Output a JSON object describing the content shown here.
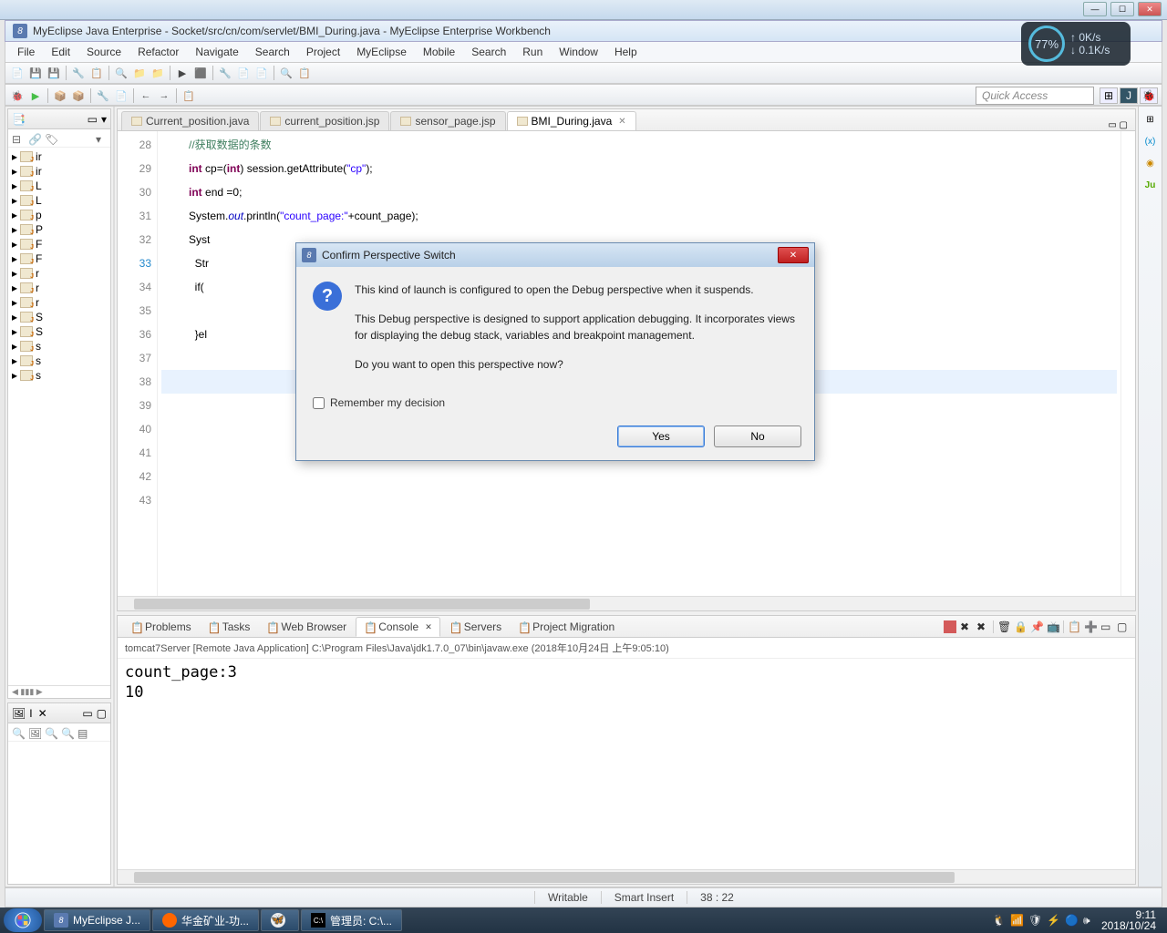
{
  "window": {
    "title": "MyEclipse Java Enterprise - Socket/src/cn/com/servlet/BMI_During.java - MyEclipse Enterprise Workbench"
  },
  "menu": [
    "File",
    "Edit",
    "Source",
    "Refactor",
    "Navigate",
    "Search",
    "Project",
    "MyEclipse",
    "Mobile",
    "Search",
    "Run",
    "Window",
    "Help"
  ],
  "quick_access": "Quick Access",
  "net": {
    "pct": "77%",
    "up": "0K/s",
    "down": "0.1K/s"
  },
  "editor_tabs": [
    {
      "label": "Current_position.java"
    },
    {
      "label": "current_position.jsp"
    },
    {
      "label": "sensor_page.jsp"
    },
    {
      "label": "BMI_During.java",
      "active": true
    }
  ],
  "gutter": [
    "28",
    "29",
    "30",
    "31",
    "32",
    "33",
    "34",
    "35",
    "36",
    "37",
    "38",
    "39",
    "40",
    "41",
    "42",
    "43"
  ],
  "code_lines": {
    "l28c": "//获取数据的条数",
    "l29a": "int",
    "l29b": "cp=(",
    "l29c": "int",
    "l29d": ") session.getAttribute(",
    "l29e": "\"cp\"",
    "l29f": ");",
    "l30a": "int",
    "l30b": "end =0;",
    "l31a": "System.",
    "l31b": "out",
    "l31c": ".println(",
    "l31d": "\"count_page:\"",
    "l31e": "+count_page);",
    "l32": "Syst",
    "l33": " Str",
    "l34": " if(",
    "l36": " }el"
  },
  "pkg_items": [
    "ir",
    "ir",
    "L",
    "L",
    "p",
    "P",
    "F",
    "F",
    "r",
    "r",
    "r",
    "S",
    "S",
    "s",
    "s",
    "s"
  ],
  "image_tab": "I",
  "console_tabs": [
    {
      "label": "Problems"
    },
    {
      "label": "Tasks"
    },
    {
      "label": "Web Browser"
    },
    {
      "label": "Console",
      "active": true
    },
    {
      "label": "Servers"
    },
    {
      "label": "Project Migration"
    }
  ],
  "console_title": "tomcat7Server [Remote Java Application] C:\\Program Files\\Java\\jdk1.7.0_07\\bin\\javaw.exe (2018年10月24日 上午9:05:10)",
  "console_body": "count_page:3\n10",
  "status": {
    "mode": "Writable",
    "ins": "Smart Insert",
    "pos": "38 : 22"
  },
  "dialog": {
    "title": "Confirm Perspective Switch",
    "p1": "This kind of launch is configured to open the Debug perspective when it suspends.",
    "p2": "This Debug perspective is designed to support application debugging. It incorporates views for displaying the debug stack, variables and breakpoint management.",
    "p3": "Do you want to open this perspective now?",
    "remember": "Remember my decision",
    "yes": "Yes",
    "no": "No"
  },
  "taskbar": {
    "items": [
      "MyEclipse J...",
      "华金矿业-功...",
      "",
      "管理员: C:\\..."
    ],
    "clock_time": "9:11",
    "clock_date": "2018/10/24"
  }
}
